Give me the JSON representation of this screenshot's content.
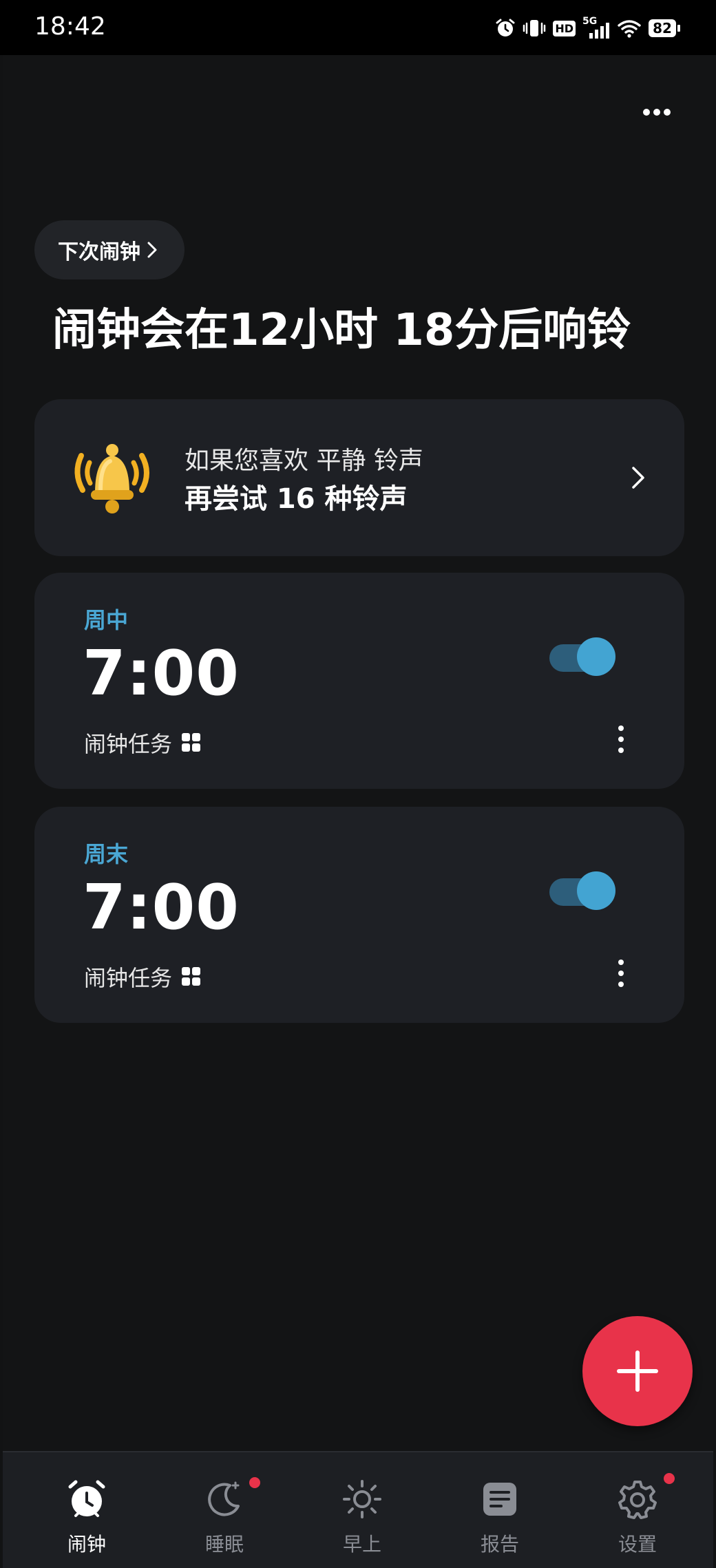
{
  "status_bar": {
    "time": "18:42",
    "network": "5G",
    "hd_label": "HD",
    "battery": "82",
    "icons": [
      "alarm-icon",
      "vibrate-icon",
      "hd-icon",
      "signal-icon",
      "wifi-icon",
      "battery-icon"
    ]
  },
  "header": {
    "more_icon": "more-horizontal-icon",
    "next_alarm_chip": "下次闹钟",
    "countdown": "闹钟会在12小时 18分后响铃"
  },
  "promo": {
    "line1": "如果您喜欢 平静 铃声",
    "line2": "再尝试 16 种铃声",
    "icon": "bell-icon"
  },
  "alarms": [
    {
      "label": "周中",
      "time": "7:00",
      "mission": "闹钟任务",
      "enabled": true
    },
    {
      "label": "周末",
      "time": "7:00",
      "mission": "闹钟任务",
      "enabled": true
    }
  ],
  "fab": {
    "icon": "plus-icon"
  },
  "colors": {
    "accent": "#e8334a",
    "toggle": "#43a4d2",
    "label_blue": "#4aa7d4",
    "background": "#131415",
    "card": "#1e2025"
  },
  "nav": [
    {
      "label": "闹钟",
      "icon": "alarm-clock-icon",
      "active": true,
      "badge": false
    },
    {
      "label": "睡眠",
      "icon": "moon-icon",
      "active": false,
      "badge": true
    },
    {
      "label": "早上",
      "icon": "sun-icon",
      "active": false,
      "badge": false
    },
    {
      "label": "报告",
      "icon": "report-icon",
      "active": false,
      "badge": false
    },
    {
      "label": "设置",
      "icon": "gear-icon",
      "active": false,
      "badge": true
    }
  ]
}
